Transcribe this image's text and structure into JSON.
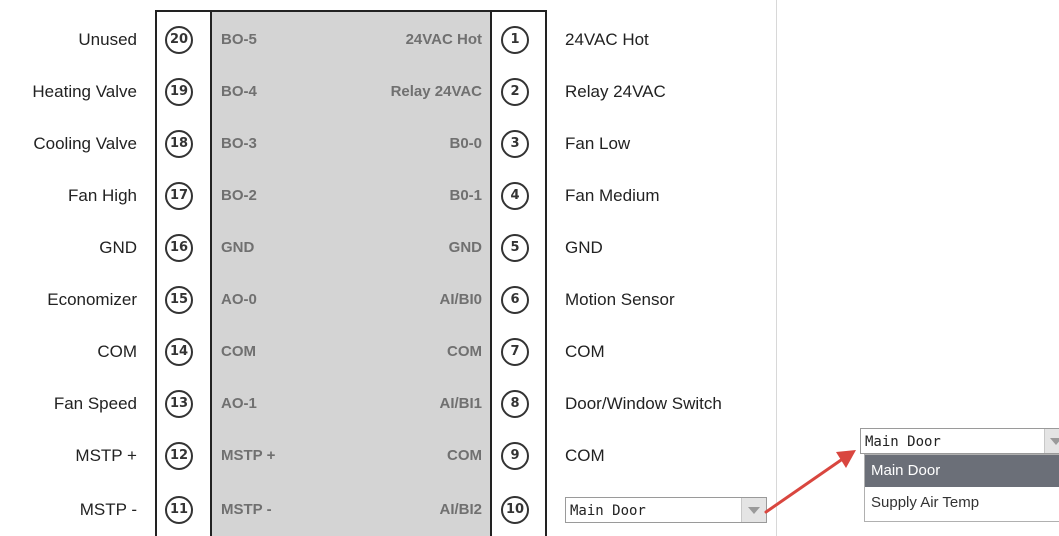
{
  "left_labels": [
    "Unused",
    "Heating Valve",
    "Cooling Valve",
    "Fan High",
    "GND",
    "Economizer",
    "COM",
    "Fan Speed",
    "MSTP +",
    "MSTP -"
  ],
  "left_pins": [
    "20",
    "19",
    "18",
    "17",
    "16",
    "15",
    "14",
    "13",
    "12",
    "11"
  ],
  "left_terminals": [
    "BO-5",
    "BO-4",
    "BO-3",
    "BO-2",
    "GND",
    "AO-0",
    "COM",
    "AO-1",
    "MSTP +",
    "MSTP -"
  ],
  "right_terminals": [
    "24VAC Hot",
    "Relay 24VAC",
    "B0-0",
    "B0-1",
    "GND",
    "AI/BI0",
    "COM",
    "AI/BI1",
    "COM",
    "AI/BI2"
  ],
  "right_pins": [
    "1",
    "2",
    "3",
    "4",
    "5",
    "6",
    "7",
    "8",
    "9",
    "10"
  ],
  "right_labels": [
    "24VAC Hot",
    "Relay 24VAC",
    "Fan Low",
    "Fan Medium",
    "GND",
    "Motion Sensor",
    "COM",
    "Door/Window Switch",
    "COM"
  ],
  "inline_select": {
    "value": "Main Door"
  },
  "dropdown": {
    "value": "Main Door",
    "options": [
      "Main Door",
      "Supply Air Temp"
    ],
    "selected_index": 0
  },
  "colors": {
    "terminal_band": "#d4d4d4",
    "selected_option": "#6b6f78",
    "arrow": "#d9463f"
  },
  "icons": {
    "dropdown_caret": "caret-down-icon",
    "callout_arrow": "arrow-icon"
  }
}
